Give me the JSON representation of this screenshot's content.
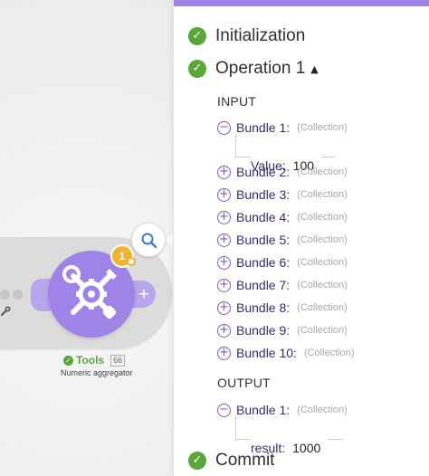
{
  "module": {
    "name": "Tools",
    "id": "66",
    "subtitle": "Numeric aggregator",
    "operations_badge": "1",
    "accent": "#9f83e6",
    "status_color": "#5aa63a",
    "icon": "wrench-screwdriver-gear-icon"
  },
  "inspector": {
    "sections": {
      "initialization": "Initialization",
      "operation": "Operation 1",
      "commit": "Commit"
    },
    "input_label": "INPUT",
    "output_label": "OUTPUT",
    "collection_label": "(Collection)",
    "input_bundles": [
      {
        "label": "Bundle 1:",
        "expanded": true,
        "toggle": "−"
      },
      {
        "label": "Bundle 2:",
        "expanded": false,
        "toggle": "+"
      },
      {
        "label": "Bundle 3:",
        "expanded": false,
        "toggle": "+"
      },
      {
        "label": "Bundle 4:",
        "expanded": false,
        "toggle": "+"
      },
      {
        "label": "Bundle 5:",
        "expanded": false,
        "toggle": "+"
      },
      {
        "label": "Bundle 6:",
        "expanded": false,
        "toggle": "+"
      },
      {
        "label": "Bundle 7:",
        "expanded": false,
        "toggle": "+"
      },
      {
        "label": "Bundle 8:",
        "expanded": false,
        "toggle": "+"
      },
      {
        "label": "Bundle 9:",
        "expanded": false,
        "toggle": "+"
      },
      {
        "label": "Bundle 10:",
        "expanded": false,
        "toggle": "+"
      }
    ],
    "input_value": {
      "key": "Value:",
      "value": "100"
    },
    "output_bundles": [
      {
        "label": "Bundle 1:",
        "expanded": true,
        "toggle": "−"
      }
    ],
    "output_value": {
      "key": "result:",
      "value": "1000"
    }
  }
}
